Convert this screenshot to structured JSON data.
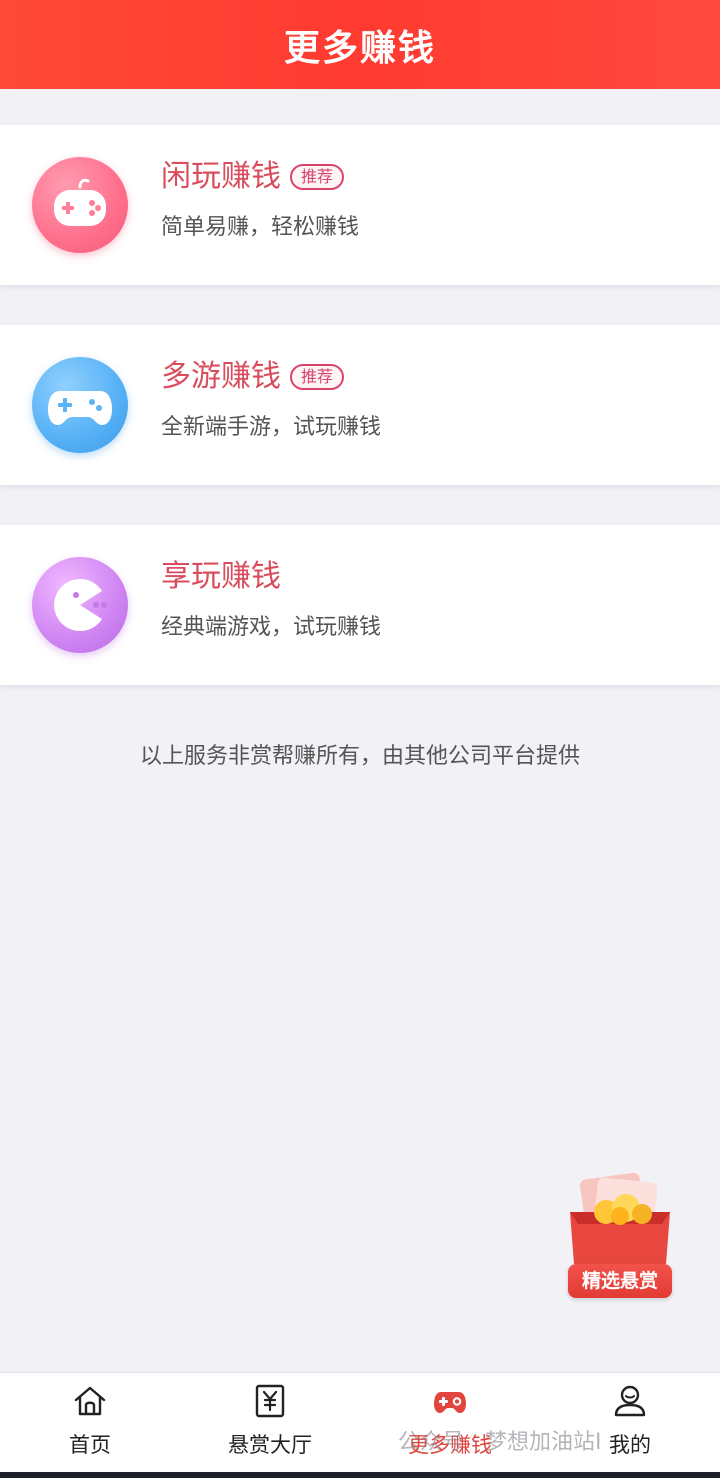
{
  "header": {
    "title": "更多赚钱"
  },
  "cards": [
    {
      "title": "闲玩赚钱",
      "badge": "推荐",
      "subtitle": "简单易赚，轻松赚钱",
      "icon": "gamepad-round-icon",
      "color": "#ff6f8c"
    },
    {
      "title": "多游赚钱",
      "badge": "推荐",
      "subtitle": "全新端手游，试玩赚钱",
      "icon": "gamepad-icon",
      "color": "#55b0f5"
    },
    {
      "title": "享玩赚钱",
      "badge": "",
      "subtitle": "经典端游戏，试玩赚钱",
      "icon": "pacman-icon",
      "color": "#cf84f2"
    }
  ],
  "footnote": "以上服务非赏帮赚所有，由其他公司平台提供",
  "float_button": {
    "label": "精选悬赏",
    "icon": "red-envelope-gold-icon"
  },
  "tabbar": [
    {
      "label": "首页",
      "icon": "home-icon"
    },
    {
      "label": "悬赏大厅",
      "icon": "yuan-doc-icon"
    },
    {
      "label": "更多赚钱",
      "icon": "gamepad-active-icon",
      "active": true
    },
    {
      "label": "我的",
      "icon": "user-icon"
    }
  ],
  "watermark": "公众号 · 梦想加油站I",
  "colors": {
    "header": "#ff3a30",
    "title": "#d94d5c",
    "active_tab": "#e2453d",
    "page_bg": "#f2f1f6"
  }
}
